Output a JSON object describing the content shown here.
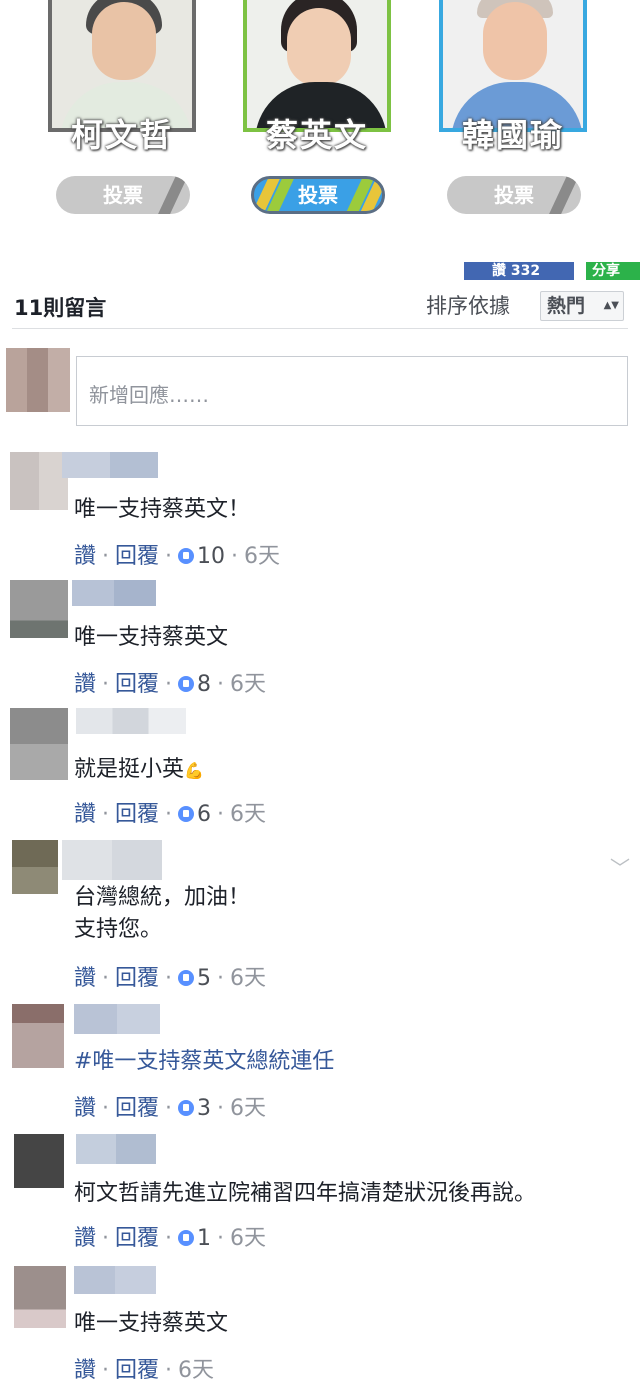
{
  "candidates": [
    {
      "name": "柯文哲",
      "vote_label": "投票",
      "frame_color": "#6b6b6b",
      "active": false
    },
    {
      "name": "蔡英文",
      "vote_label": "投票",
      "frame_color": "#7dc243",
      "active": true
    },
    {
      "name": "韓國瑜",
      "vote_label": "投票",
      "frame_color": "#38a8e0",
      "active": false
    }
  ],
  "share": {
    "like_count": "讚 332",
    "share_label": "分享"
  },
  "comments_header": {
    "count_label": "11則留言",
    "sort_label": "排序依據",
    "sort_value": "熱門"
  },
  "new_comment": {
    "placeholder": "新增回應……"
  },
  "comments": [
    {
      "text": "唯一支持蔡英文！",
      "like": "讚",
      "reply": "回覆",
      "likes": "10",
      "time": "6天"
    },
    {
      "text": "唯一支持蔡英文",
      "like": "讚",
      "reply": "回覆",
      "likes": "8",
      "time": "6天"
    },
    {
      "text": "就是挺小英",
      "like": "讚",
      "reply": "回覆",
      "likes": "6",
      "time": "6天"
    },
    {
      "text": "台灣總統，加油！\n支持您。",
      "like": "讚",
      "reply": "回覆",
      "likes": "5",
      "time": "6天"
    },
    {
      "text": "#唯一支持蔡英文總統連任",
      "like": "讚",
      "reply": "回覆",
      "likes": "3",
      "time": "6天"
    },
    {
      "text": "柯文哲請先進立院補習四年搞清楚狀況後再說。",
      "like": "讚",
      "reply": "回覆",
      "likes": "1",
      "time": "6天"
    },
    {
      "text": "唯一支持蔡英文",
      "like": "讚",
      "reply": "回覆",
      "likes": "",
      "time": "6天"
    }
  ],
  "colors": {
    "link": "#365899",
    "fb_blue": "#4267b2",
    "share_green": "#2cb24a"
  }
}
